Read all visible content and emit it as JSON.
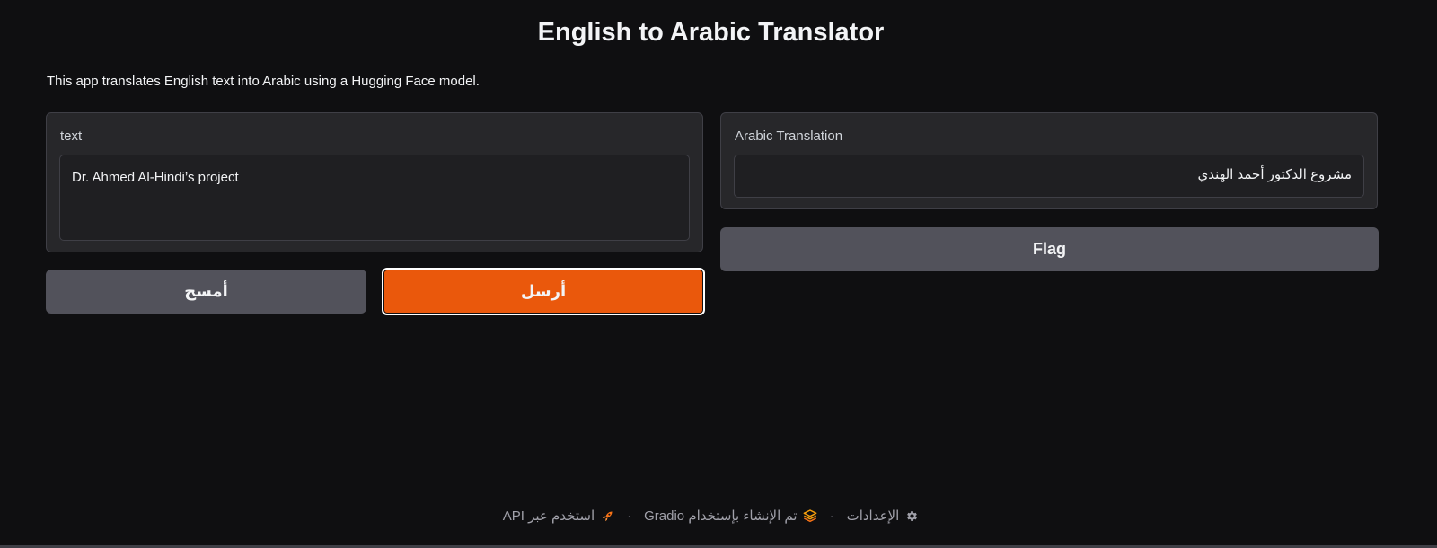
{
  "header": {
    "title": "English to Arabic Translator",
    "description": "This app translates English text into Arabic using a Hugging Face model."
  },
  "input_panel": {
    "label": "text",
    "value": "Dr. Ahmed Al-Hindi’s project"
  },
  "output_panel": {
    "label": "Arabic Translation",
    "value": "مشروع الدكتور أحمد الهندي"
  },
  "buttons": {
    "clear_label": "أمسح",
    "submit_label": "أرسل",
    "flag_label": "Flag"
  },
  "footer": {
    "settings_label": "الإعدادات",
    "built_with_label": "تم الإنشاء بإستخدام Gradio",
    "api_label": "استخدم عبر API",
    "separator": "·",
    "icons": {
      "settings": "gear-icon",
      "built_with": "gradio-logo-icon",
      "api": "rocket-icon"
    }
  },
  "colors": {
    "background": "#0f0f11",
    "panel": "#27272a",
    "primary_button": "#ea580c",
    "secondary_button": "#52525b"
  }
}
